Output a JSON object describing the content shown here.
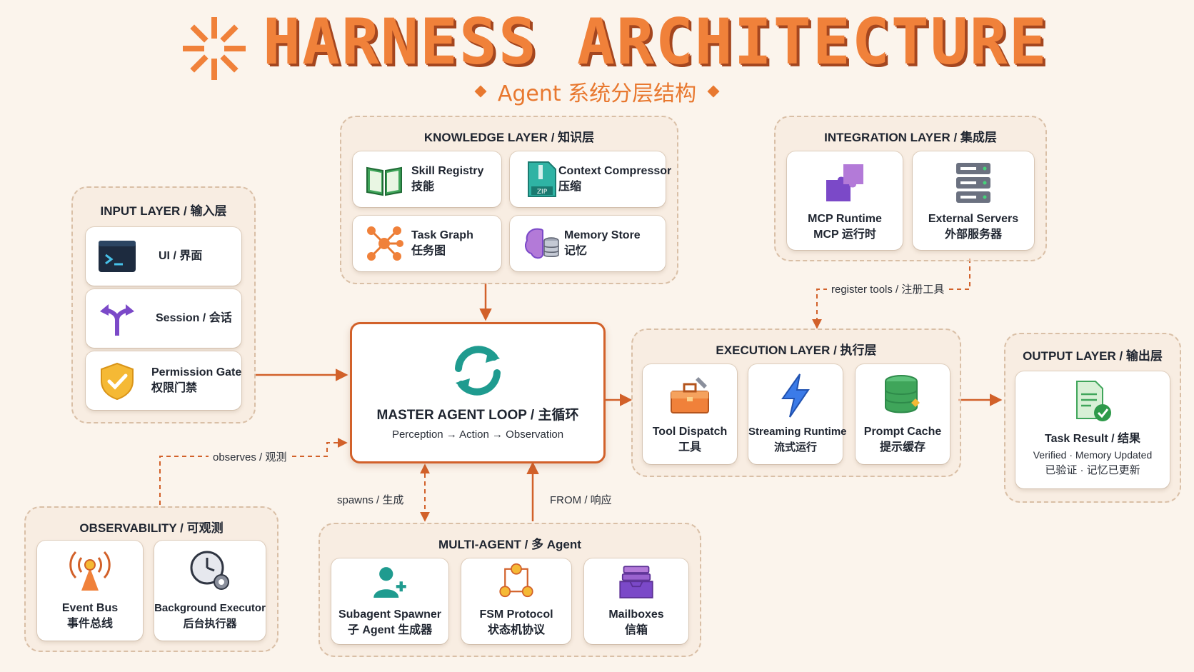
{
  "title": "HARNESS ARCHITECTURE",
  "subtitle": "Agent 系统分层结构",
  "colors": {
    "accent": "#e8782f",
    "accent_dark": "#d2612a",
    "background": "#fbf4ec",
    "teal": "#1f9b8f"
  },
  "layers": {
    "input": {
      "title": "INPUT LAYER / 输入层",
      "items": [
        {
          "line1": "UI / 界面",
          "line2": "",
          "icon": "terminal-icon"
        },
        {
          "line1": "Session / 会话",
          "line2": "",
          "icon": "fork-arrows-icon"
        },
        {
          "line1": "Permission Gate",
          "line2": "权限门禁",
          "icon": "shield-check-icon"
        }
      ]
    },
    "knowledge": {
      "title": "KNOWLEDGE LAYER / 知识层",
      "items": [
        {
          "line1": "Skill Registry",
          "line2": "技能",
          "icon": "book-icon"
        },
        {
          "line1": "Context Compressor",
          "line2": "压缩",
          "icon": "zip-file-icon"
        },
        {
          "line1": "Task Graph",
          "line2": "任务图",
          "icon": "graph-nodes-icon"
        },
        {
          "line1": "Memory Store",
          "line2": "记忆",
          "icon": "brain-database-icon"
        }
      ]
    },
    "integration": {
      "title": "INTEGRATION LAYER / 集成层",
      "items": [
        {
          "line1": "MCP Runtime",
          "line2": "MCP 运行时",
          "icon": "puzzle-icon"
        },
        {
          "line1": "External Servers",
          "line2": "外部服务器",
          "icon": "server-rack-icon"
        }
      ]
    },
    "execution": {
      "title": "EXECUTION LAYER / 执行层",
      "items": [
        {
          "line1": "Tool Dispatch",
          "line2": "工具",
          "icon": "toolbox-icon"
        },
        {
          "line1": "Streaming Runtime",
          "line2": "流式运行",
          "icon": "lightning-icon"
        },
        {
          "line1": "Prompt Cache",
          "line2": "提示缓存",
          "icon": "database-cache-icon"
        }
      ]
    },
    "output": {
      "title": "OUTPUT LAYER / 输出层",
      "item": {
        "line1": "Task Result / 结果",
        "line2": "Verified · Memory Updated",
        "line3": "已验证 · 记忆已更新",
        "icon": "verified-document-icon"
      }
    },
    "observability": {
      "title": "OBSERVABILITY / 可观测",
      "items": [
        {
          "line1": "Event Bus",
          "line2": "事件总线",
          "icon": "broadcast-icon"
        },
        {
          "line1": "Background Executor",
          "line2": "后台执行器",
          "icon": "clock-gear-icon"
        }
      ]
    },
    "multi_agent": {
      "title": "MULTI-AGENT / 多 Agent",
      "items": [
        {
          "line1": "Subagent Spawner",
          "line2": "子 Agent 生成器",
          "icon": "add-user-icon"
        },
        {
          "line1": "FSM Protocol",
          "line2": "状态机协议",
          "icon": "state-machine-icon"
        },
        {
          "line1": "Mailboxes",
          "line2": "信箱",
          "icon": "inbox-tray-icon"
        }
      ]
    }
  },
  "master": {
    "title": "MASTER AGENT LOOP / 主循环",
    "subtitle": "Perception → Action → Observation",
    "icon": "refresh-cycle-icon"
  },
  "edges": {
    "register": "register tools / 注册工具",
    "observes": "observes / 观测",
    "spawns": "spawns / 生成",
    "from": "FROM / 响应"
  }
}
